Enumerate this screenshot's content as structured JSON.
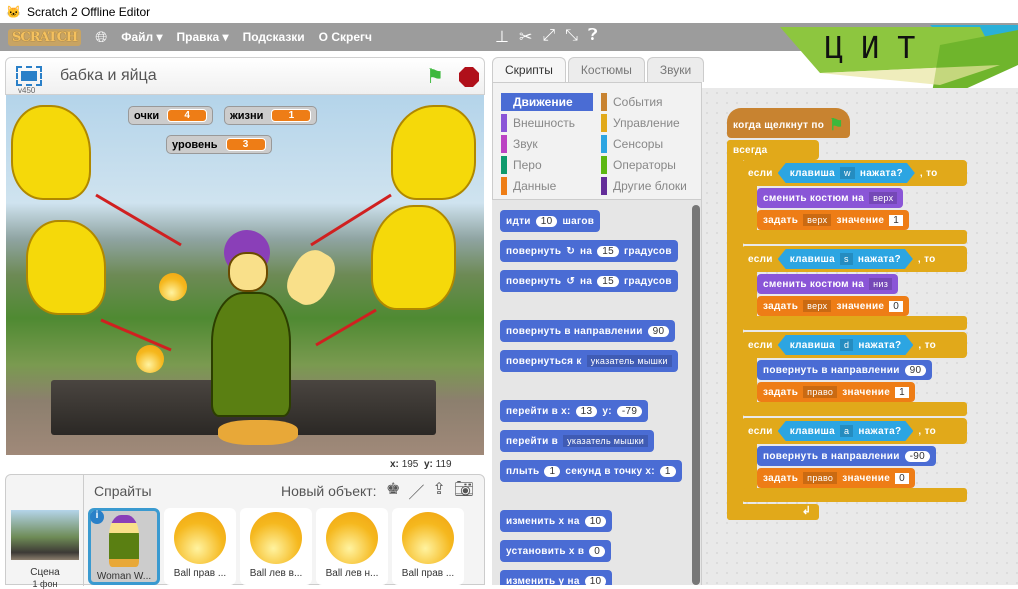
{
  "window": {
    "title": "Scratch 2 Offline Editor"
  },
  "menu": {
    "logo": "SCRATCH",
    "items": [
      "Файл ▾",
      "Правка ▾",
      "Подсказки",
      "О Скрегч"
    ],
    "toolbar_icons": [
      "duplicate-icon",
      "cut-icon",
      "grow-icon",
      "shrink-icon",
      "help-icon"
    ],
    "brand": "Ц И Т"
  },
  "stage": {
    "project_title": "бабка и яйца",
    "version": "v450",
    "monitors": [
      {
        "label": "очки",
        "value": "4"
      },
      {
        "label": "жизни",
        "value": "1"
      },
      {
        "label": "уровень",
        "value": "3"
      }
    ],
    "mouse_x_label": "x:",
    "mouse_x": "195",
    "mouse_y_label": "y:",
    "mouse_y": "119"
  },
  "tabs": [
    "Скрипты",
    "Костюмы",
    "Звуки"
  ],
  "categories": [
    {
      "label": "Движение",
      "color": "#4a6cd4",
      "active": true
    },
    {
      "label": "События",
      "color": "#c88330"
    },
    {
      "label": "Внешность",
      "color": "#8a55d7"
    },
    {
      "label": "Управление",
      "color": "#e1a91a"
    },
    {
      "label": "Звук",
      "color": "#bb42c3"
    },
    {
      "label": "Сенсоры",
      "color": "#2ca5e2"
    },
    {
      "label": "Перо",
      "color": "#0e9a6c"
    },
    {
      "label": "Операторы",
      "color": "#5cb712"
    },
    {
      "label": "Данные",
      "color": "#ee7d16"
    },
    {
      "label": "Другие блоки",
      "color": "#632d99"
    }
  ],
  "palette": {
    "move": [
      "идти",
      "10",
      "шагов"
    ],
    "turn_right": [
      "повернуть",
      "↻",
      "на",
      "15",
      "градусов"
    ],
    "turn_left": [
      "повернуть",
      "↺",
      "на",
      "15",
      "градусов"
    ],
    "point_dir": [
      "повернуть в направлении",
      "90"
    ],
    "point_towards": [
      "повернуться к",
      "указатель мышки"
    ],
    "goto_xy": [
      "перейти в x:",
      "13",
      "y:",
      "-79"
    ],
    "goto": [
      "перейти в",
      "указатель мышки"
    ],
    "glide": [
      "плыть",
      "1",
      "секунд в точку x:",
      "1"
    ],
    "change_x": [
      "изменить x на",
      "10"
    ],
    "set_x": [
      "установить x в",
      "0"
    ],
    "change_y": [
      "изменить y на",
      "10"
    ]
  },
  "script": {
    "hat": "когда щелкнут по",
    "forever": "всегда",
    "if_label": "если",
    "key_label": "клавиша",
    "pressed_label": "нажата?",
    "then_label": ", то",
    "ifs": [
      {
        "key": "w",
        "action": [
          "сменить костюм на",
          "верх"
        ],
        "set": [
          "задать",
          "верх",
          "значение",
          "1"
        ],
        "type": "looks"
      },
      {
        "key": "s",
        "action": [
          "сменить костюм на",
          "низ"
        ],
        "set": [
          "задать",
          "верх",
          "значение",
          "0"
        ],
        "type": "looks"
      },
      {
        "key": "d",
        "action": [
          "повернуть в направлении",
          "90"
        ],
        "set": [
          "задать",
          "право",
          "значение",
          "1"
        ],
        "type": "motion"
      },
      {
        "key": "a",
        "action": [
          "повернуть в направлении",
          "-90"
        ],
        "set": [
          "задать",
          "право",
          "значение",
          "0"
        ],
        "type": "motion"
      }
    ]
  },
  "sprites": {
    "title": "Спрайты",
    "new_label": "Новый объект:",
    "stage_label": "Сцена",
    "stage_sub": "1 фон",
    "items": [
      "Woman W...",
      "Ball прав ...",
      "Ball лев в...",
      "Ball лев н...",
      "Ball прав ..."
    ]
  }
}
